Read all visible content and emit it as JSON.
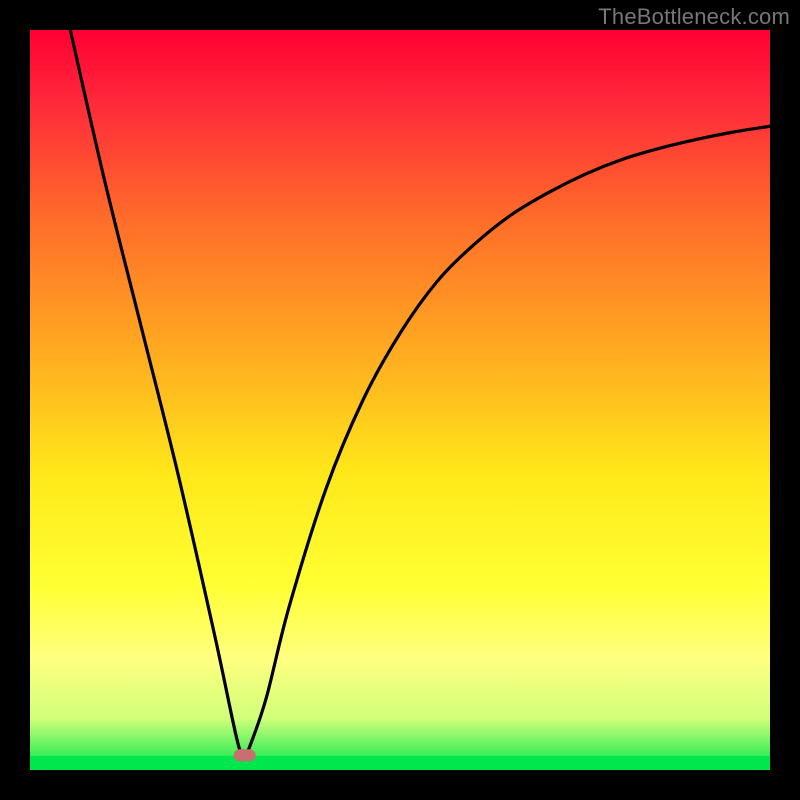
{
  "watermark": "TheBottleneck.com",
  "chart_data": {
    "type": "line",
    "title": "",
    "xlabel": "",
    "ylabel": "",
    "xlim": [
      0,
      100
    ],
    "ylim": [
      0,
      100
    ],
    "grid": false,
    "legend": false,
    "bottom_band_color": "#00e64d",
    "gradient_stops": [
      {
        "offset": 0,
        "color": "#ff0033"
      },
      {
        "offset": 10,
        "color": "#ff2a3a"
      },
      {
        "offset": 25,
        "color": "#ff6a2a"
      },
      {
        "offset": 45,
        "color": "#ffb020"
      },
      {
        "offset": 60,
        "color": "#ffe81a"
      },
      {
        "offset": 75,
        "color": "#ffff33"
      },
      {
        "offset": 85,
        "color": "#ffff80"
      },
      {
        "offset": 93,
        "color": "#d2ff7a"
      },
      {
        "offset": 100,
        "color": "#00e64d"
      }
    ],
    "marker": {
      "x": 29,
      "y": 2,
      "color": "#c86f6f"
    },
    "series": [
      {
        "name": "curve",
        "color": "#000000",
        "points": [
          {
            "x": 5,
            "y": 102
          },
          {
            "x": 10,
            "y": 80
          },
          {
            "x": 15,
            "y": 60
          },
          {
            "x": 20,
            "y": 40
          },
          {
            "x": 25,
            "y": 18
          },
          {
            "x": 28,
            "y": 4
          },
          {
            "x": 29,
            "y": 2
          },
          {
            "x": 30,
            "y": 4
          },
          {
            "x": 32,
            "y": 10
          },
          {
            "x": 35,
            "y": 22
          },
          {
            "x": 40,
            "y": 38
          },
          {
            "x": 45,
            "y": 50
          },
          {
            "x": 50,
            "y": 59
          },
          {
            "x": 55,
            "y": 66
          },
          {
            "x": 60,
            "y": 71
          },
          {
            "x": 65,
            "y": 75
          },
          {
            "x": 70,
            "y": 78
          },
          {
            "x": 75,
            "y": 80.5
          },
          {
            "x": 80,
            "y": 82.5
          },
          {
            "x": 85,
            "y": 84
          },
          {
            "x": 90,
            "y": 85.2
          },
          {
            "x": 95,
            "y": 86.2
          },
          {
            "x": 100,
            "y": 87
          }
        ]
      }
    ]
  }
}
